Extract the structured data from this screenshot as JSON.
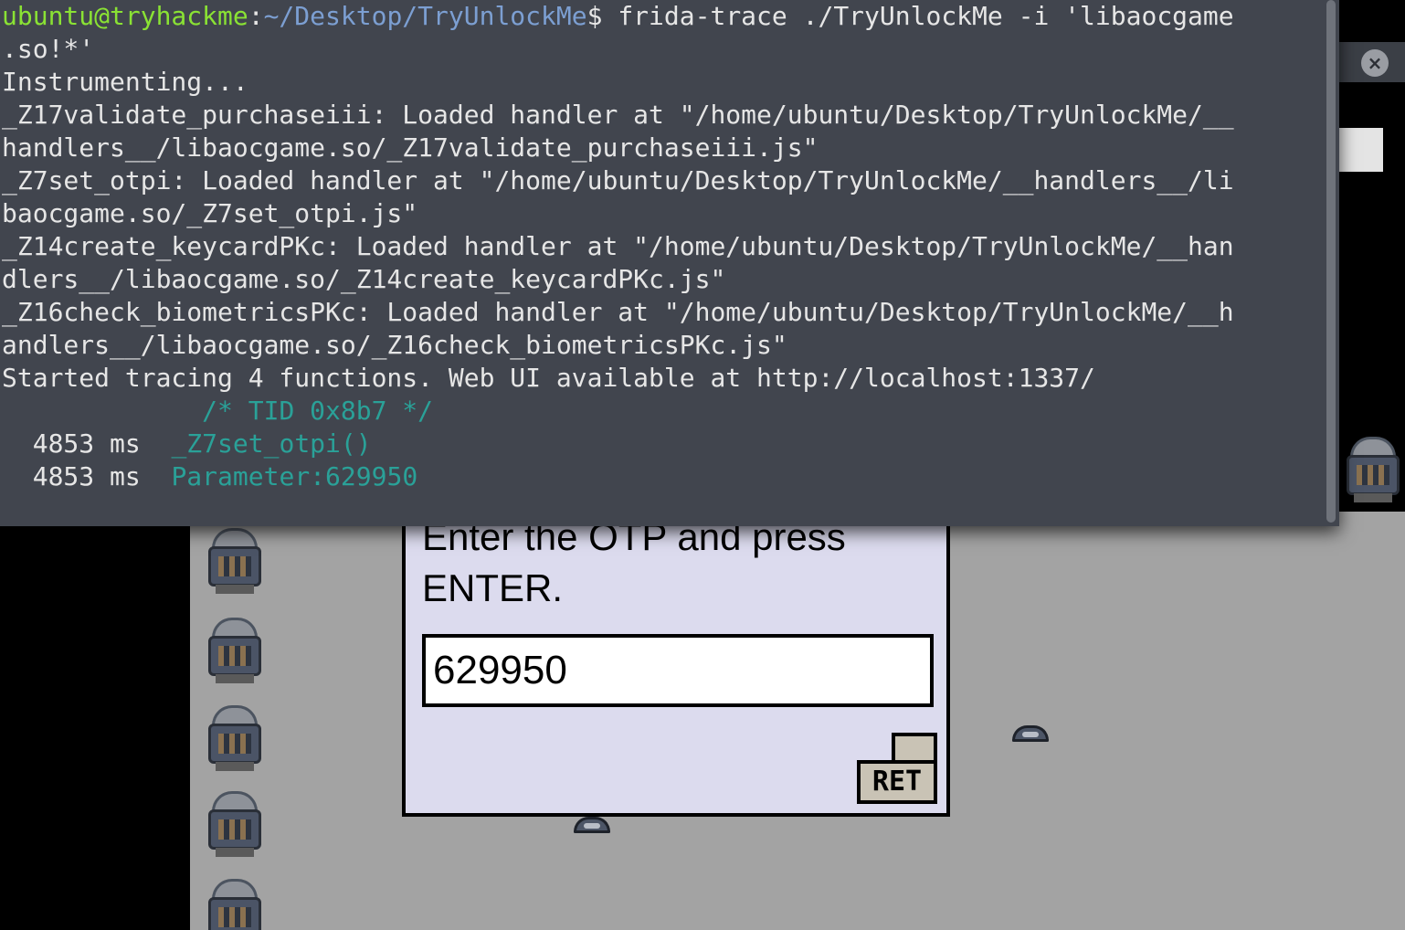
{
  "terminal": {
    "prompt_user": "ubuntu@tryhackme",
    "prompt_sep": ":",
    "prompt_path": "~/Desktop/TryUnlockMe",
    "prompt_symbol": "$ ",
    "command_line1": "frida-trace ./TryUnlockMe -i 'libaocgame",
    "command_line2": ".so!*'",
    "output": [
      "Instrumenting...",
      "_Z17validate_purchaseiii: Loaded handler at \"/home/ubuntu/Desktop/TryUnlockMe/__",
      "handlers__/libaocgame.so/_Z17validate_purchaseiii.js\"",
      "_Z7set_otpi: Loaded handler at \"/home/ubuntu/Desktop/TryUnlockMe/__handlers__/li",
      "baocgame.so/_Z7set_otpi.js\"",
      "_Z14create_keycardPKc: Loaded handler at \"/home/ubuntu/Desktop/TryUnlockMe/__han",
      "dlers__/libaocgame.so/_Z14create_keycardPKc.js\"",
      "_Z16check_biometricsPKc: Loaded handler at \"/home/ubuntu/Desktop/TryUnlockMe/__h",
      "andlers__/libaocgame.so/_Z16check_biometricsPKc.js\"",
      "Started tracing 4 functions. Web UI available at http://localhost:1337/"
    ],
    "tid_comment": "/* TID 0x8b7 */",
    "trace": [
      {
        "time": "4853 ms",
        "text": "_Z7set_otpi()"
      },
      {
        "time": "4853 ms",
        "text": "Parameter:629950"
      }
    ],
    "colors": {
      "background": "#41454e",
      "user": "#8ae234",
      "path": "#7c9fd2",
      "trace": "#2aa198"
    }
  },
  "right_panel": {
    "close_icon": "close-icon"
  },
  "dialog": {
    "prompt_line1": "Enter the OTP and press",
    "prompt_line2": "ENTER.",
    "otp_value": "629950",
    "ret_key_label": "RET"
  }
}
